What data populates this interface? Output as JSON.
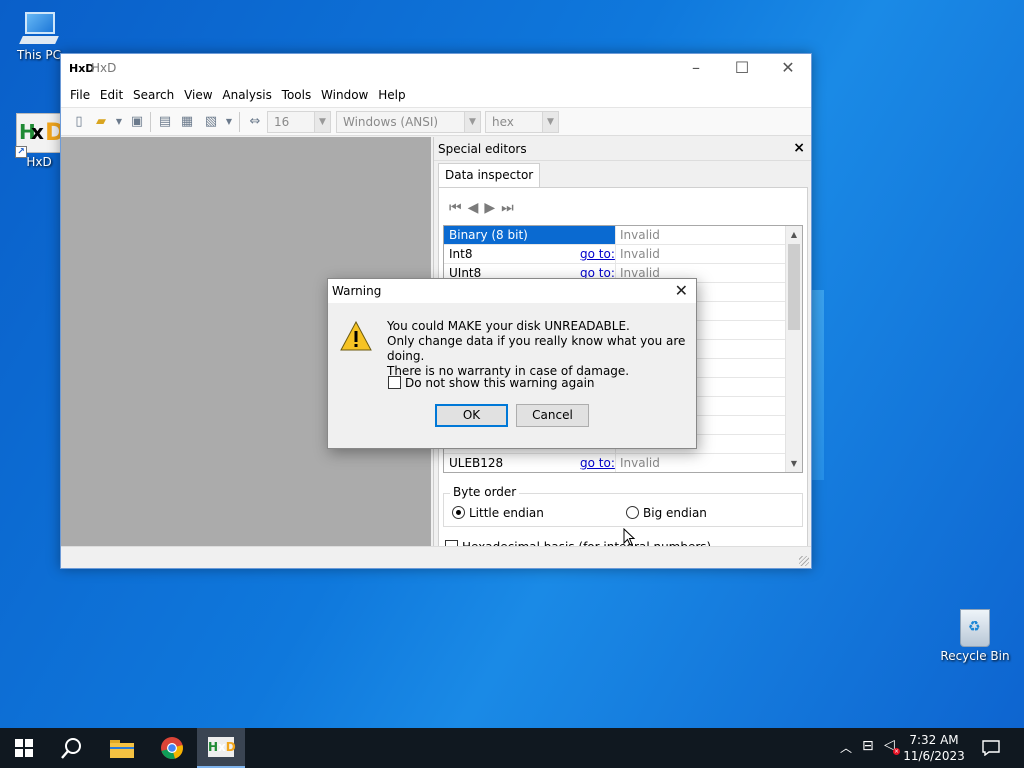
{
  "desktop": {
    "icons": [
      {
        "label": "This PC"
      },
      {
        "label": "HxD"
      },
      {
        "label": "Recycle Bin"
      }
    ]
  },
  "window": {
    "title": "HxD",
    "menu": [
      "File",
      "Edit",
      "Search",
      "View",
      "Analysis",
      "Tools",
      "Window",
      "Help"
    ],
    "toolbar": {
      "bytes_per_row": "16",
      "charset": "Windows (ANSI)",
      "offset_base": "hex"
    },
    "special_editors": {
      "title": "Special editors",
      "close": "×",
      "tab": "Data inspector",
      "rows": [
        {
          "name": "Binary (8 bit)",
          "goto": "",
          "value": "Invalid",
          "selected": true
        },
        {
          "name": "Int8",
          "goto": "go to:",
          "value": "Invalid"
        },
        {
          "name": "UInt8",
          "goto": "go to:",
          "value": "Invalid"
        },
        {
          "name": "ULEB128",
          "goto": "go to:",
          "value": "Invalid"
        }
      ],
      "byte_order": {
        "legend": "Byte order",
        "options": [
          {
            "label": "Little endian",
            "checked": true
          },
          {
            "label": "Big endian",
            "checked": false
          }
        ]
      },
      "hex_basis_label": "Hexadecimal basis (for integral numbers)"
    }
  },
  "dialog": {
    "title": "Warning",
    "message_lines": [
      "You could MAKE your disk UNREADABLE.",
      "Only change data if you really know what you are doing.",
      "There is no warranty in case of damage."
    ],
    "checkbox_label": "Do not show this warning again",
    "ok_label": "OK",
    "cancel_label": "Cancel"
  },
  "taskbar": {
    "time": "7:32 AM",
    "date": "11/6/2023"
  },
  "colors": {
    "accent": "#0078d7",
    "selection": "#0a6ad1",
    "link": "#0000cc"
  }
}
